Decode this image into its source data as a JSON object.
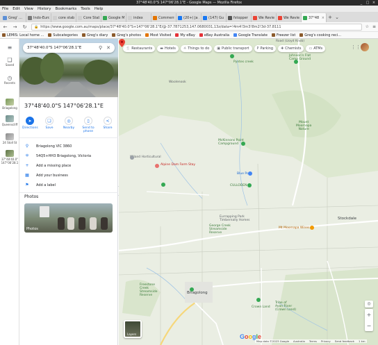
{
  "window": {
    "title": "37°48'40.0\"S 147°06'28.1\"E - Google Maps — Mozilla Firefox",
    "controls": [
      "_",
      "□",
      "×"
    ]
  },
  "menubar": [
    "File",
    "Edit",
    "View",
    "History",
    "Bookmarks",
    "Tools",
    "Help"
  ],
  "tabs": [
    {
      "label": "Greg' …",
      "color": "#5c8fd6"
    },
    {
      "label": "Indo-Euro …",
      "color": "#7a7a7a"
    },
    {
      "label": "core stab …",
      "color": "#cfcfcf"
    },
    {
      "label": "Core Stab …",
      "color": "#cfcfcf"
    },
    {
      "label": "Google M …",
      "color": "#34a853"
    },
    {
      "label": "index",
      "color": "#cfcfcf"
    },
    {
      "label": "Comment …",
      "color": "#e37400"
    },
    {
      "label": "(20+) Ja …",
      "color": "#1877f2"
    },
    {
      "label": "(147) Gu …",
      "color": "#1877f2"
    },
    {
      "label": "fstopper …",
      "color": "#555555"
    },
    {
      "label": "We Revie …",
      "color": "#ea4335"
    },
    {
      "label": "We Revie …",
      "color": "#ea4335"
    },
    {
      "label": "37°48 …",
      "color": "#34a853",
      "active": true
    }
  ],
  "navbar": {
    "url": "https://www.google.com.au/maps/place/37°48'40.0\"S+147°06'28.1\"E/@-37.7871253,147.0680031,13z/data=!4m4!3m3!8m2!3d-37.8111",
    "back": "←",
    "forward": "→",
    "reload": "↻",
    "lock": "🔒",
    "star": "☆",
    "menu": "≡"
  },
  "bookmarks": [
    {
      "label": "LEMIS: Local home ...",
      "color": "#8b5a2b"
    },
    {
      "label": "Subcategories",
      "color": "#8b5a2b"
    },
    {
      "label": "Greg's diary",
      "color": "#8b5a2b"
    },
    {
      "label": "Greg's photos",
      "color": "#8b5a2b"
    },
    {
      "label": "Most Visited",
      "color": "#e37400"
    },
    {
      "label": "My eBay",
      "color": "#e53238"
    },
    {
      "label": "eBay Australia",
      "color": "#e53238"
    },
    {
      "label": "Google Translate",
      "color": "#4285f4"
    },
    {
      "label": "Freezer list",
      "color": "#8b5a2b"
    },
    {
      "label": "Greg's cooking reci...",
      "color": "#8b5a2b"
    }
  ],
  "rail": {
    "menu_icon": "≡",
    "items": [
      {
        "label": "Saved",
        "icon": "bookmark-icon",
        "glyph": "❏"
      },
      {
        "label": "Recents",
        "icon": "history-icon",
        "glyph": "◷"
      },
      {
        "label": "Briagolong",
        "icon": "place-thumb"
      },
      {
        "label": "Queenscliff",
        "icon": "place-thumb"
      },
      {
        "label": "24 Stoll St",
        "icon": "place-thumb"
      },
      {
        "label": "37°48'40.0\" 147°06'28.1",
        "icon": "place-thumb"
      }
    ]
  },
  "panel": {
    "search_value": "37°48'40.0\"S 147°06'28.1\"E",
    "title": "37°48'40.0\"S 147°06'28.1\"E",
    "actions": [
      {
        "label": "Directions",
        "glyph": "➤",
        "filled": true
      },
      {
        "label": "Save",
        "glyph": "❏"
      },
      {
        "label": "Nearby",
        "glyph": "◎"
      },
      {
        "label": "Send to phone",
        "glyph": "▯"
      },
      {
        "label": "Share",
        "glyph": "<"
      }
    ],
    "info": [
      {
        "text": "Briagolong VIC 3860",
        "glyph": "⚲"
      },
      {
        "text": "54Q5+HH3 Briagolong, Victoria",
        "glyph": "⁜"
      },
      {
        "text": "Add a missing place",
        "glyph": "+"
      },
      {
        "text": "Add your business",
        "glyph": "▦"
      },
      {
        "text": "Add a label",
        "glyph": "⚑"
      }
    ],
    "photos_heading": "Photos",
    "photos_label": "Photos"
  },
  "map": {
    "chips": [
      {
        "label": "Restaurants",
        "glyph": "🍴"
      },
      {
        "label": "Hotels",
        "glyph": "▬"
      },
      {
        "label": "Things to do",
        "glyph": "☼"
      },
      {
        "label": "Public transport",
        "glyph": "▣"
      },
      {
        "label": "Parking",
        "glyph": "P"
      },
      {
        "label": "Chemists",
        "glyph": "✚"
      },
      {
        "label": "ATMs",
        "glyph": "▭"
      }
    ],
    "labels": {
      "road_lloyd_knob": "Road (Lloyd Knob)",
      "pyntes_creek": "Pyntes creek",
      "johnsons_flat": "Johnson's Flat\nCamp Ground",
      "woolenook": "Woolenook",
      "mount_moornapa": "Mount\nMoornapa\nNature",
      "mckinnons": "McKinnons Point\nCampground",
      "kilworth_horticultural": "Killand Horticultural",
      "alpine_dam": "Alpine Dam Farm Stay",
      "blue_pool": "Blue Pool",
      "culloden": "CULLODEN",
      "eurrapping_park": "Eurrapping Park\nTimbernally Homes",
      "mt_moornapa_wines": "Mt Moornapa Wines",
      "stockdale": "Stockdale",
      "george_creek": "George Creek\nStreamside\nReserve",
      "freestone_creek": "Freestone\nCreek\nStreamside\nReserve",
      "briagolong": "Briagolong",
      "crown_land": "Crown Land",
      "avon_river": "Tribe of\nAvon River\n(Crown Land)",
      "layers": "Layers",
      "google": "Google"
    },
    "footer": [
      "Map data ©2023 Google",
      "Australia",
      "Terms",
      "Privacy",
      "Send feedback",
      "1 km"
    ],
    "zoom_in": "+",
    "zoom_out": "−",
    "locate": "◎",
    "apps": "⋮⋮⋮"
  }
}
